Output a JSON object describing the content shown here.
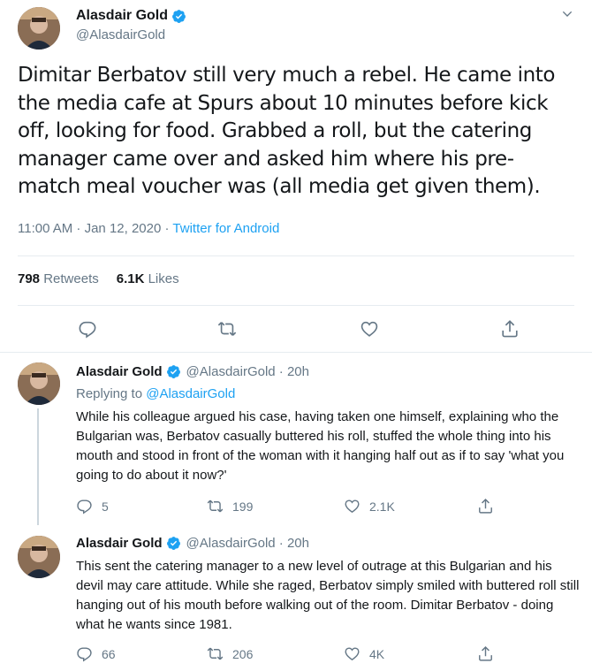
{
  "main": {
    "display_name": "Alasdair Gold",
    "handle": "@AlasdairGold",
    "text": "Dimitar Berbatov still very much a rebel. He came into the media cafe at Spurs about 10 minutes before kick off, looking for food. Grabbed a roll, but the catering manager came over and asked him where his pre-match meal voucher was (all media get given them).",
    "time": "11:00 AM · Jan 12, 2020 · ",
    "source": "Twitter for Android",
    "retweets_count": "798",
    "retweets_label": "Retweets",
    "likes_count": "6.1K",
    "likes_label": "Likes"
  },
  "replies": [
    {
      "display_name": "Alasdair Gold",
      "handle": "@AlasdairGold · 20h",
      "replying_prefix": "Replying to ",
      "replying_to": "@AlasdairGold",
      "text": "While his colleague argued his case, having taken one himself, explaining who the Bulgarian was, Berbatov casually buttered his roll, stuffed the whole thing into his mouth and stood in front of the woman with it hanging half out as if to say 'what you going to do about it now?'",
      "reply_count": "5",
      "retweet_count": "199",
      "like_count": "2.1K"
    },
    {
      "display_name": "Alasdair Gold",
      "handle": "@AlasdairGold · 20h",
      "text": "This sent the catering manager to a new level of outrage at this Bulgarian and his devil may care attitude. While she raged, Berbatov simply smiled with buttered roll still hanging out of his mouth before walking out of the room. Dimitar Berbatov - doing what he wants since 1981.",
      "reply_count": "66",
      "retweet_count": "206",
      "like_count": "4K"
    }
  ],
  "colors": {
    "accent": "#1da1f2",
    "secondary_text": "#657786",
    "primary_text": "#14171a",
    "divider": "#e6ecf0"
  },
  "icons": [
    "verified-badge-icon",
    "chevron-down-icon",
    "reply-icon",
    "retweet-icon",
    "like-icon",
    "share-icon"
  ]
}
